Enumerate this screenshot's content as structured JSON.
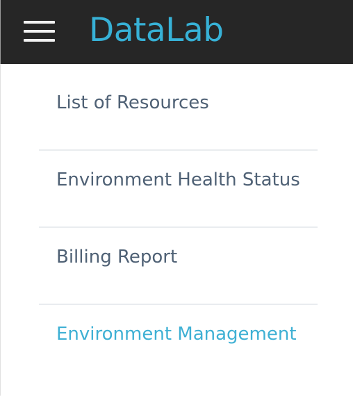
{
  "header": {
    "menu_icon": "hamburger-menu-icon",
    "brand": "DataLab",
    "brand_color": "#37b1d6",
    "background_color": "#262626"
  },
  "menu": {
    "items": [
      {
        "label": "List of Resources",
        "active": false
      },
      {
        "label": "Environment Health Status",
        "active": false
      },
      {
        "label": "Billing Report",
        "active": false
      },
      {
        "label": "Environment Management",
        "active": true
      }
    ],
    "text_color": "#4f6175",
    "active_color": "#3eb0d4"
  }
}
